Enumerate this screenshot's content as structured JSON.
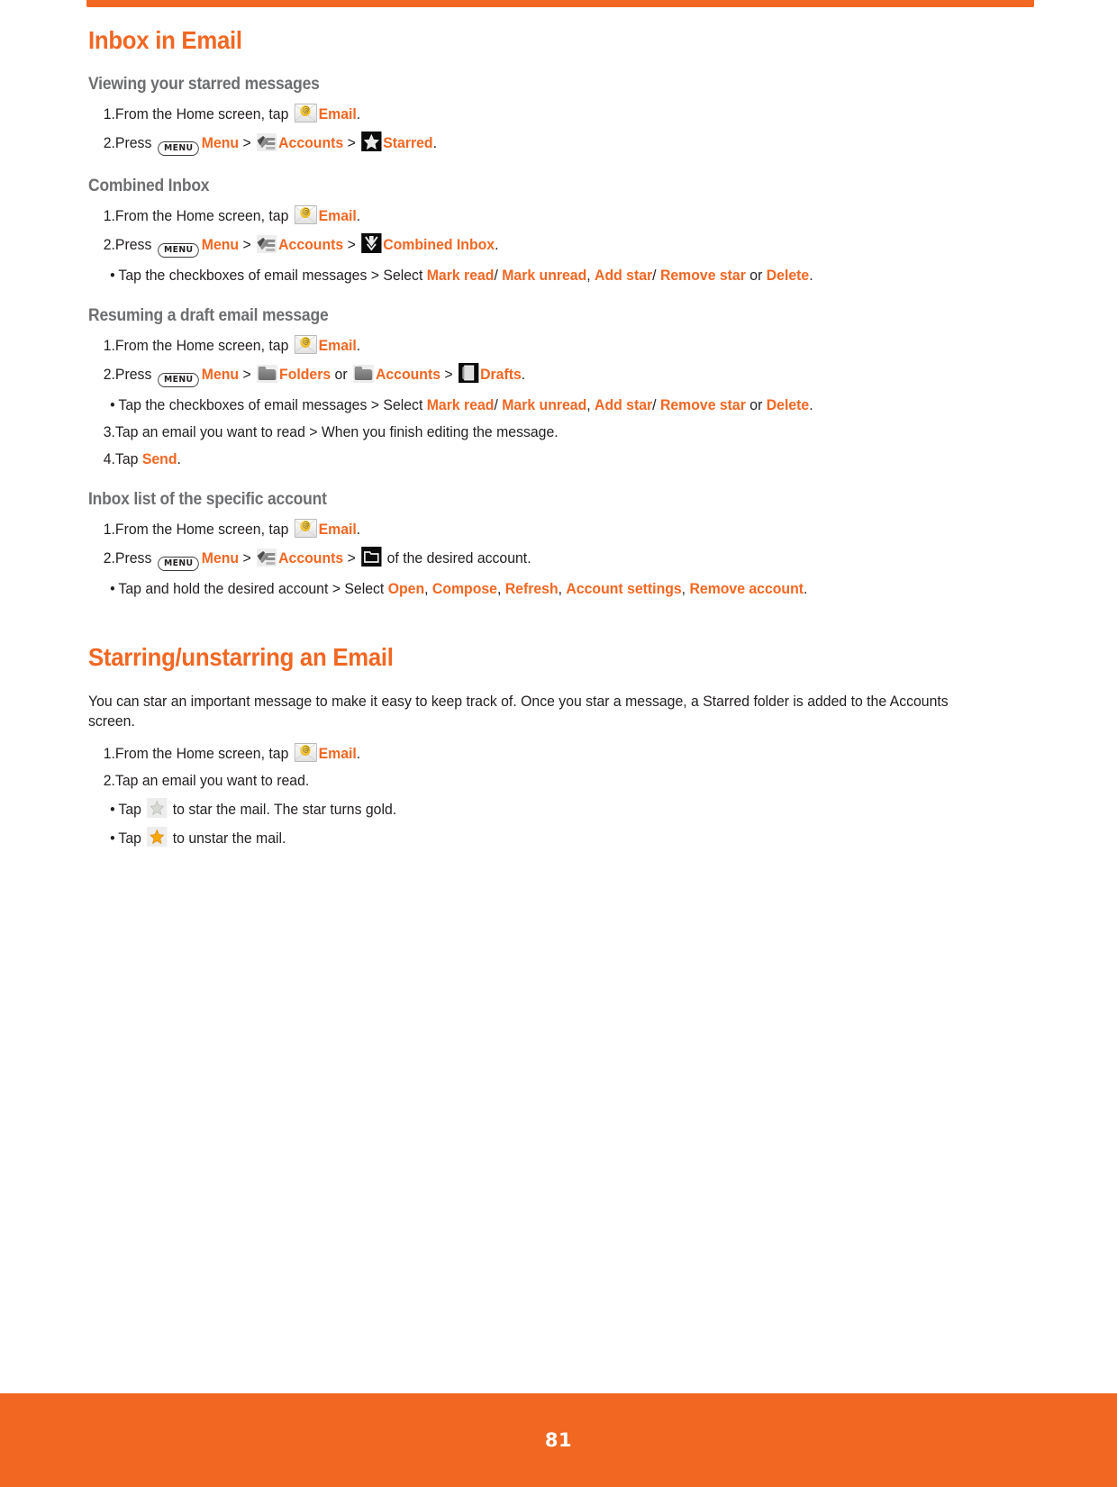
{
  "page": {
    "number": "81",
    "accent_color": "#f26722",
    "heading_color": "#f26722",
    "subheading_color": "#6d6e70",
    "body_color": "#231f20"
  },
  "sections": [
    {
      "title": "Inbox in Email",
      "subsections": [
        {
          "heading": "Viewing your starred messages",
          "steps": [
            {
              "marker": "1.",
              "parts": [
                {
                  "t": "From the Home screen, tap ",
                  "style": "plain"
                },
                {
                  "icon": "email-icon"
                },
                {
                  "t": "Email",
                  "style": "orange"
                },
                {
                  "t": ".",
                  "style": "plain"
                }
              ]
            },
            {
              "marker": "2.",
              "parts": [
                {
                  "t": "Press ",
                  "style": "plain"
                },
                {
                  "icon": "menu-key-icon",
                  "label": "MENU"
                },
                {
                  "t": "Menu",
                  "style": "orange"
                },
                {
                  "t": " > ",
                  "style": "plain"
                },
                {
                  "icon": "accounts-icon"
                },
                {
                  "t": "Accounts",
                  "style": "orange"
                },
                {
                  "t": " > ",
                  "style": "plain"
                },
                {
                  "icon": "starred-icon"
                },
                {
                  "t": "Starred",
                  "style": "orange"
                },
                {
                  "t": ".",
                  "style": "plain"
                }
              ]
            }
          ]
        },
        {
          "heading": "Combined Inbox",
          "steps": [
            {
              "marker": "1.",
              "parts": [
                {
                  "t": "From the Home screen, tap ",
                  "style": "plain"
                },
                {
                  "icon": "email-icon"
                },
                {
                  "t": "Email",
                  "style": "orange"
                },
                {
                  "t": ".",
                  "style": "plain"
                }
              ]
            },
            {
              "marker": "2.",
              "parts": [
                {
                  "t": "Press ",
                  "style": "plain"
                },
                {
                  "icon": "menu-key-icon",
                  "label": "MENU"
                },
                {
                  "t": "Menu",
                  "style": "orange"
                },
                {
                  "t": " > ",
                  "style": "plain"
                },
                {
                  "icon": "accounts-icon"
                },
                {
                  "t": "Accounts",
                  "style": "orange"
                },
                {
                  "t": " > ",
                  "style": "plain"
                },
                {
                  "icon": "combined-inbox-icon"
                },
                {
                  "t": "Combined Inbox",
                  "style": "orange"
                },
                {
                  "t": ".",
                  "style": "plain"
                }
              ]
            },
            {
              "marker": "•",
              "bullet": true,
              "parts": [
                {
                  "t": "Tap the checkboxes of email messages > Select ",
                  "style": "plain"
                },
                {
                  "t": "Mark read",
                  "style": "orange"
                },
                {
                  "t": "/ ",
                  "style": "plain"
                },
                {
                  "t": "Mark unread",
                  "style": "orange"
                },
                {
                  "t": ", ",
                  "style": "plain"
                },
                {
                  "t": "Add star",
                  "style": "orange"
                },
                {
                  "t": "/ ",
                  "style": "plain"
                },
                {
                  "t": "Remove star",
                  "style": "orange"
                },
                {
                  "t": " or ",
                  "style": "plain"
                },
                {
                  "t": "Delete",
                  "style": "orange"
                },
                {
                  "t": ".",
                  "style": "plain"
                }
              ]
            }
          ]
        },
        {
          "heading": "Resuming a draft email message",
          "steps": [
            {
              "marker": "1.",
              "parts": [
                {
                  "t": "From the Home screen, tap ",
                  "style": "plain"
                },
                {
                  "icon": "email-icon"
                },
                {
                  "t": "Email",
                  "style": "orange"
                },
                {
                  "t": ".",
                  "style": "plain"
                }
              ]
            },
            {
              "marker": "2.",
              "parts": [
                {
                  "t": "Press ",
                  "style": "plain"
                },
                {
                  "icon": "menu-key-icon",
                  "label": "MENU"
                },
                {
                  "t": "Menu",
                  "style": "orange"
                },
                {
                  "t": " > ",
                  "style": "plain"
                },
                {
                  "icon": "folder-icon"
                },
                {
                  "t": "Folders",
                  "style": "orange"
                },
                {
                  "t": " or ",
                  "style": "plain"
                },
                {
                  "icon": "folder-icon"
                },
                {
                  "t": "Accounts",
                  "style": "orange"
                },
                {
                  "t": " > ",
                  "style": "plain"
                },
                {
                  "icon": "drafts-icon"
                },
                {
                  "t": "Drafts",
                  "style": "orange"
                },
                {
                  "t": ".",
                  "style": "plain"
                }
              ]
            },
            {
              "marker": "•",
              "bullet": true,
              "parts": [
                {
                  "t": "Tap the checkboxes of email messages > Select ",
                  "style": "plain"
                },
                {
                  "t": "Mark read",
                  "style": "orange"
                },
                {
                  "t": "/ ",
                  "style": "plain"
                },
                {
                  "t": "Mark unread",
                  "style": "orange"
                },
                {
                  "t": ", ",
                  "style": "plain"
                },
                {
                  "t": "Add star",
                  "style": "orange"
                },
                {
                  "t": "/ ",
                  "style": "plain"
                },
                {
                  "t": "Remove star",
                  "style": "orange"
                },
                {
                  "t": " or ",
                  "style": "plain"
                },
                {
                  "t": "Delete",
                  "style": "orange"
                },
                {
                  "t": ".",
                  "style": "plain"
                }
              ]
            },
            {
              "marker": "3.",
              "parts": [
                {
                  "t": "Tap an email you want to read > When you finish editing the message.",
                  "style": "plain"
                }
              ]
            },
            {
              "marker": "4.",
              "parts": [
                {
                  "t": "Tap ",
                  "style": "plain"
                },
                {
                  "t": "Send",
                  "style": "orange"
                },
                {
                  "t": ".",
                  "style": "plain"
                }
              ]
            }
          ]
        },
        {
          "heading": "Inbox list of the specific account",
          "steps": [
            {
              "marker": "1.",
              "parts": [
                {
                  "t": "From the Home screen, tap ",
                  "style": "plain"
                },
                {
                  "icon": "email-icon"
                },
                {
                  "t": "Email",
                  "style": "orange"
                },
                {
                  "t": ".",
                  "style": "plain"
                }
              ]
            },
            {
              "marker": "2.",
              "parts": [
                {
                  "t": "Press ",
                  "style": "plain"
                },
                {
                  "icon": "menu-key-icon",
                  "label": "MENU"
                },
                {
                  "t": "Menu",
                  "style": "orange"
                },
                {
                  "t": " > ",
                  "style": "plain"
                },
                {
                  "icon": "accounts-icon"
                },
                {
                  "t": "Accounts",
                  "style": "orange"
                },
                {
                  "t": " > ",
                  "style": "plain"
                },
                {
                  "icon": "account-folder-icon"
                },
                {
                  "t": " of the desired account.",
                  "style": "plain"
                }
              ]
            },
            {
              "marker": "•",
              "bullet": true,
              "parts": [
                {
                  "t": "Tap and hold the desired account > Select ",
                  "style": "plain"
                },
                {
                  "t": "Open",
                  "style": "orange"
                },
                {
                  "t": ", ",
                  "style": "plain"
                },
                {
                  "t": "Compose",
                  "style": "orange"
                },
                {
                  "t": ", ",
                  "style": "plain"
                },
                {
                  "t": "Refresh",
                  "style": "orange"
                },
                {
                  "t": ", ",
                  "style": "plain"
                },
                {
                  "t": "Account settings",
                  "style": "orange"
                },
                {
                  "t": ", ",
                  "style": "plain"
                },
                {
                  "t": "Remove account",
                  "style": "orange"
                },
                {
                  "t": ".",
                  "style": "plain"
                }
              ]
            }
          ]
        }
      ]
    },
    {
      "title": "Starring/unstarring an Email",
      "intro": "You can star an important message to make it easy to keep track of. Once you star a message, a Starred folder is added to the Accounts screen.",
      "subsections": [
        {
          "heading": "",
          "steps": [
            {
              "marker": "1.",
              "parts": [
                {
                  "t": "From the Home screen, tap ",
                  "style": "plain"
                },
                {
                  "icon": "email-icon"
                },
                {
                  "t": "Email",
                  "style": "orange"
                },
                {
                  "t": ".",
                  "style": "plain"
                }
              ]
            },
            {
              "marker": "2.",
              "parts": [
                {
                  "t": "Tap an email you want to read.",
                  "style": "plain"
                }
              ]
            },
            {
              "marker": "•",
              "bullet": true,
              "parts": [
                {
                  "t": "Tap ",
                  "style": "plain"
                },
                {
                  "icon": "star-empty-icon"
                },
                {
                  "t": " to star the mail. The star turns gold.",
                  "style": "plain"
                }
              ]
            },
            {
              "marker": "•",
              "bullet": true,
              "parts": [
                {
                  "t": "Tap ",
                  "style": "plain"
                },
                {
                  "icon": "star-gold-icon"
                },
                {
                  "t": " to unstar the mail.",
                  "style": "plain"
                }
              ]
            }
          ]
        }
      ]
    }
  ]
}
